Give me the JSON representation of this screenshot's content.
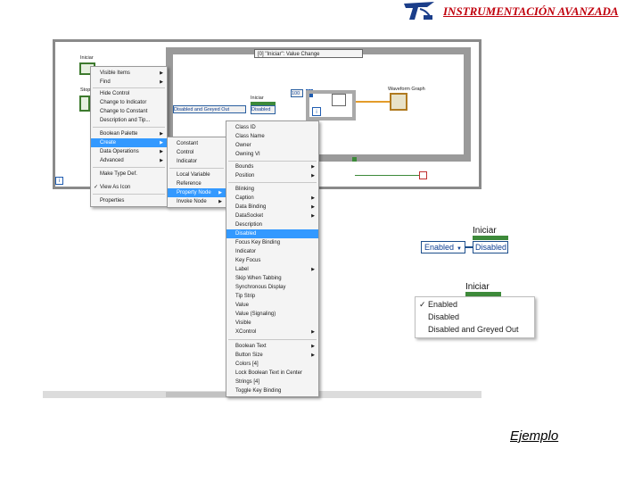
{
  "header": {
    "title": "INSTRUMENTACIÓN AVANZADA"
  },
  "diagram": {
    "event_header": "[0] \"Iniciar\": Value Change",
    "iniciar_terminal_label": "Iniciar",
    "stop_terminal_label": "Stop",
    "ring_constant": "Disabled and Greyed Out",
    "property_node_label": "Iniciar",
    "property_node_value": "Disabled",
    "count_constant": "100",
    "loop_n": "N",
    "loop_i": "i",
    "waveform_label": "Waveform Graph",
    "iteration_terminal": "i"
  },
  "menu_main": {
    "items": [
      {
        "label": "Visible Items",
        "submenu": true
      },
      {
        "label": "Find",
        "submenu": true
      },
      {
        "label": "Hide Control"
      },
      {
        "label": "Change to Indicator"
      },
      {
        "label": "Change to Constant"
      },
      {
        "label": "Description and Tip..."
      },
      {
        "label": "Boolean Palette",
        "submenu": true
      },
      {
        "label": "Create",
        "submenu": true,
        "highlight": true
      },
      {
        "label": "Data Operations",
        "submenu": true
      },
      {
        "label": "Advanced",
        "submenu": true
      },
      {
        "label": "Make Type Def."
      },
      {
        "label": "View As Icon",
        "checked": true
      },
      {
        "label": "Properties"
      }
    ]
  },
  "menu_create": {
    "items": [
      {
        "label": "Constant"
      },
      {
        "label": "Control"
      },
      {
        "label": "Indicator"
      },
      {
        "label": "Local Variable"
      },
      {
        "label": "Reference"
      },
      {
        "label": "Property Node",
        "submenu": true,
        "highlight": true
      },
      {
        "label": "Invoke Node",
        "submenu": true
      }
    ]
  },
  "menu_property": {
    "items": [
      {
        "label": "Class ID"
      },
      {
        "label": "Class Name"
      },
      {
        "label": "Owner"
      },
      {
        "label": "Owning VI"
      },
      {
        "label": "Bounds",
        "submenu": true
      },
      {
        "label": "Position",
        "submenu": true
      },
      {
        "label": "Blinking"
      },
      {
        "label": "Caption",
        "submenu": true
      },
      {
        "label": "Data Binding",
        "submenu": true
      },
      {
        "label": "DataSocket",
        "submenu": true
      },
      {
        "label": "Description"
      },
      {
        "label": "Disabled",
        "highlight": true
      },
      {
        "label": "Focus Key Binding"
      },
      {
        "label": "Indicator"
      },
      {
        "label": "Key Focus"
      },
      {
        "label": "Label",
        "submenu": true
      },
      {
        "label": "Skip When Tabbing"
      },
      {
        "label": "Synchronous Display"
      },
      {
        "label": "Tip Strip"
      },
      {
        "label": "Value"
      },
      {
        "label": "Value (Signaling)"
      },
      {
        "label": "Visible"
      },
      {
        "label": "XControl",
        "submenu": true
      },
      {
        "label": "Boolean Text",
        "submenu": true
      },
      {
        "label": "Button Size",
        "submenu": true
      },
      {
        "label": "Colors [4]"
      },
      {
        "label": "Lock Boolean Text in Center"
      },
      {
        "label": "Strings [4]"
      },
      {
        "label": "Toggle Key Binding"
      }
    ]
  },
  "example1": {
    "label": "Iniciar",
    "dropdown": "Enabled",
    "value": "Disabled"
  },
  "example2": {
    "label": "Iniciar",
    "options": [
      "Enabled",
      "Disabled",
      "Disabled and Greyed Out"
    ],
    "checked": "✓"
  },
  "footer": {
    "caption": "Ejemplo"
  },
  "icons": {
    "submenu_arrow": "▶",
    "check": "✓",
    "dropdown_arrow": "▼"
  },
  "colors": {
    "title": "#c0000c",
    "highlight": "#3399ff",
    "wire": "#e39b2a"
  }
}
